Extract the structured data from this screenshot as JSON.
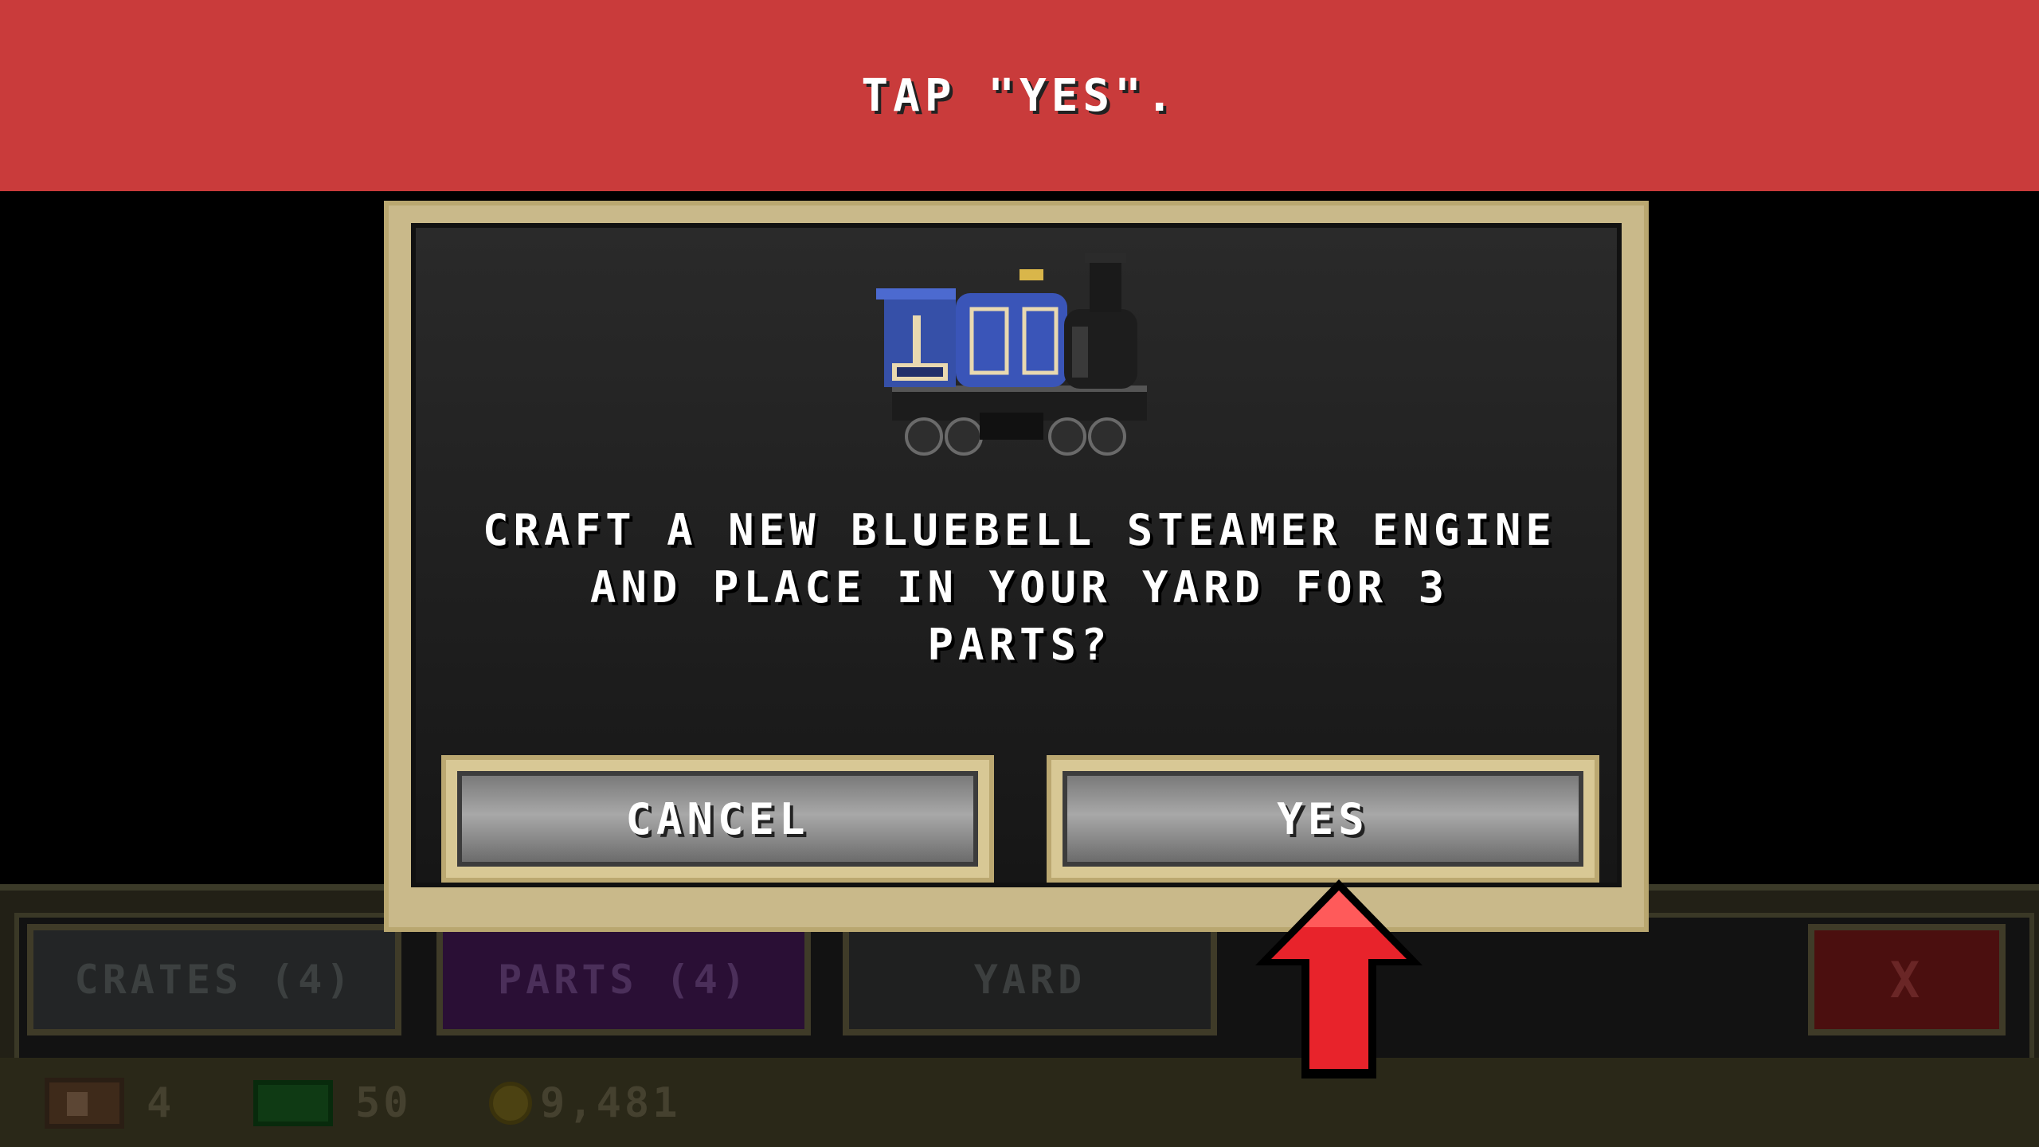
{
  "banner": {
    "text": "TAP \"YES\"."
  },
  "dialog": {
    "message_lines": [
      "CRAFT A NEW BLUEBELL STEAMER ENGINE",
      "AND PLACE IN YOUR YARD FOR 3",
      "PARTS?"
    ],
    "cancel_label": "CANCEL",
    "yes_label": "YES",
    "engine_image": "bluebell-steamer-engine-icon"
  },
  "tabs": {
    "crates": "CRATES (4)",
    "parts": "PARTS (4)",
    "yard": "YARD",
    "close": "X"
  },
  "resources": {
    "crates_count": "4",
    "cash": "50",
    "coins": "9,481"
  },
  "colors": {
    "banner": "#c93b3b",
    "dialog_frame": "#c9b98a",
    "arrow": "#e8232b"
  }
}
